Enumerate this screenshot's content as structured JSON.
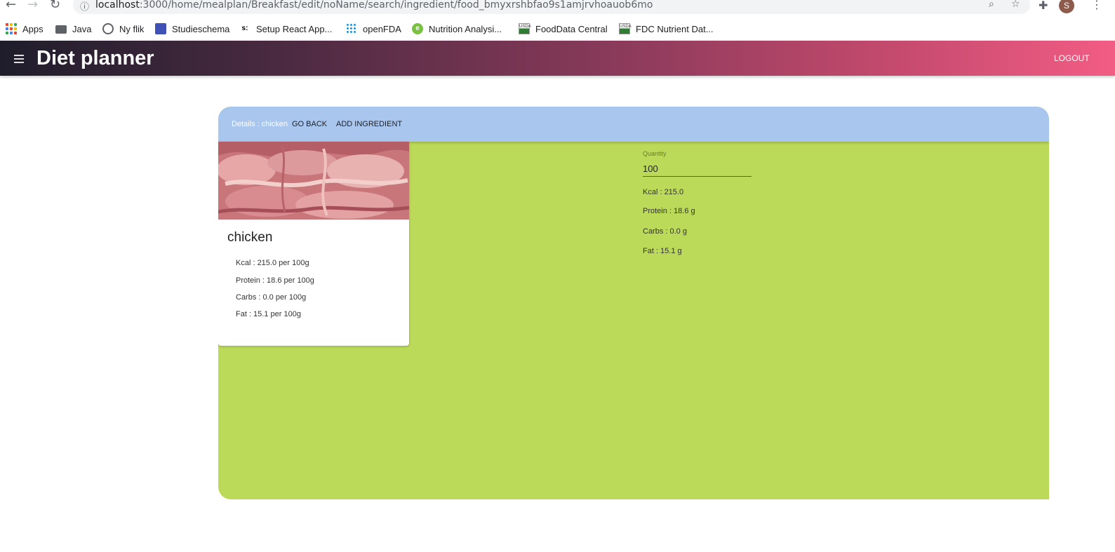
{
  "browser": {
    "url_host": "localhost",
    "url_rest": ":3000/home/mealplan/Breakfast/edit/noName/search/ingredient/food_bmyxrshbfao9s1amjrvhoauob6mo",
    "avatar_initial": "S",
    "bookmarks": [
      "Apps",
      "Java",
      "Ny flik",
      "Studieschema",
      "Setup React App...",
      "openFDA",
      "Nutrition Analysi...",
      "FoodData Central",
      "FDC Nutrient Dat..."
    ]
  },
  "app": {
    "title": "Diet planner",
    "logout_label": "LOGOUT"
  },
  "header": {
    "details_prefix": "Details :",
    "details_name": "chicken",
    "go_back_label": "GO BACK",
    "add_ingredient_label": "ADD INGREDIENT"
  },
  "food": {
    "name": "chicken",
    "per100": {
      "kcal": "Kcal : 215.0 per 100g",
      "protein": "Protein : 18.6 per 100g",
      "carbs": "Carbs : 0.0 per 100g",
      "fat": "Fat : 15.1 per 100g"
    }
  },
  "quantity": {
    "label": "Quantity",
    "value": "100"
  },
  "calculated": {
    "kcal": "Kcal : 215.0",
    "protein": "Protein : 18.6 g",
    "carbs": "Carbs : 0.0 g",
    "fat": "Fat : 15.1 g"
  },
  "colors": {
    "panel_bg": "#bcda59",
    "header_bg": "#a9c6ef",
    "appbar_start": "#1f1d2b",
    "appbar_end": "#f25c84"
  }
}
